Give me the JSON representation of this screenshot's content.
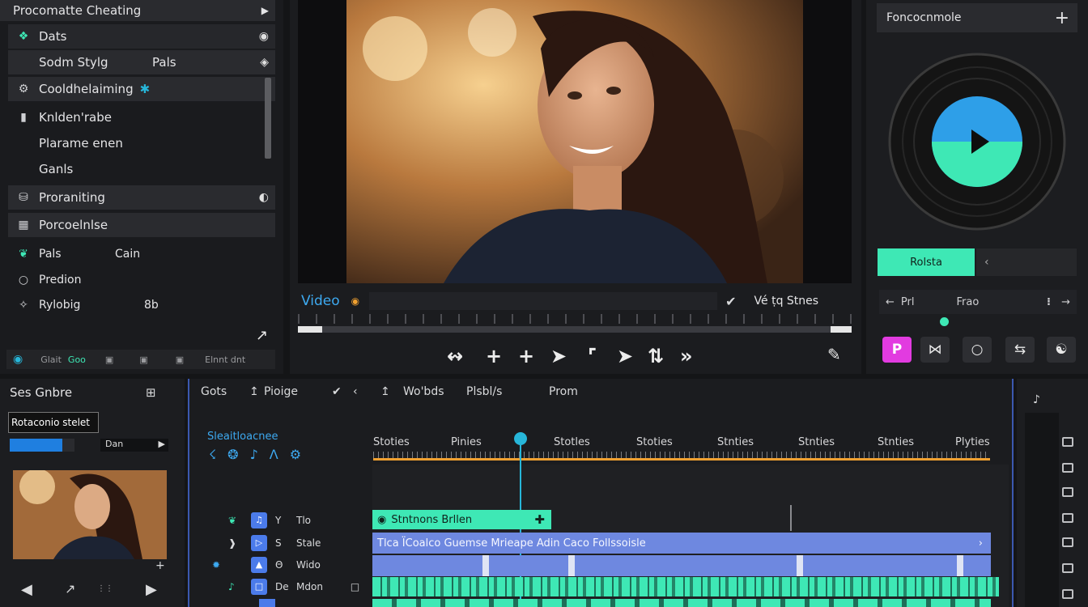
{
  "left_panel": {
    "title": "Procomatte Cheating",
    "items": [
      {
        "label": "Dats",
        "icon": "layers-icon",
        "right": "◉"
      },
      {
        "label": "Sodm Stylg",
        "icon": "",
        "right_text": "Pals",
        "right": "◈"
      },
      {
        "label": "Cooldhelaiming",
        "icon": "settings-icon",
        "extra": "✱"
      },
      {
        "label": "Knlden'rabe",
        "icon": "bookmark-icon"
      },
      {
        "label": "Plarame enen",
        "icon": ""
      },
      {
        "label": "Ganls",
        "icon": ""
      },
      {
        "label": "Proraniting",
        "icon": "shield-icon",
        "right": "⦶"
      },
      {
        "label": "Porcoelnlse",
        "icon": "grid-icon"
      },
      {
        "label": "Pals",
        "icon": "leaf-icon",
        "right_text": "Cain"
      },
      {
        "label": "Predion",
        "icon": "circle-icon"
      },
      {
        "label": "Rylobig",
        "icon": "link-icon",
        "right_text": "8b"
      }
    ],
    "footer": [
      "Glait",
      "Goo",
      "Elnnt dnt"
    ]
  },
  "preview": {
    "label": "Video",
    "right_label": "Vé ṭq  Stnes"
  },
  "right_panel": {
    "title": "Foncocnmole",
    "tab_active": "Rolsta",
    "row_left": "Prl",
    "row_mid": "Frao"
  },
  "bottom_left": {
    "title": "Ses Gnbre",
    "input_value": "Rotaconio stelet",
    "dropdown": "Dan"
  },
  "timeline": {
    "toolbar": [
      "Gots",
      "Pioige",
      "Wo'bds",
      "Plsbl/s",
      "Prom"
    ],
    "track_header": "Sleaitloacnee",
    "rulers": [
      "Stoties",
      "Pinies",
      "Stotles",
      "Stoties",
      "Stnties",
      "Stnties",
      "Stnties",
      "Plyties"
    ],
    "tracks": [
      {
        "name": "Tlo",
        "clip": "Stntnons Brllen"
      },
      {
        "name": "Stale",
        "clip": "Tlca  ÏCoalco Guemse Mrieape  Adin Caco  Follssoisle"
      },
      {
        "name": "Wido",
        "clip": ""
      },
      {
        "name": "Mdon",
        "clip": ""
      }
    ]
  },
  "colors": {
    "accent": "#3ee8b5",
    "cyan": "#27b6d9",
    "blue_clip": "#6e88e0",
    "orange": "#f0a030",
    "magenta": "#e23be0"
  }
}
